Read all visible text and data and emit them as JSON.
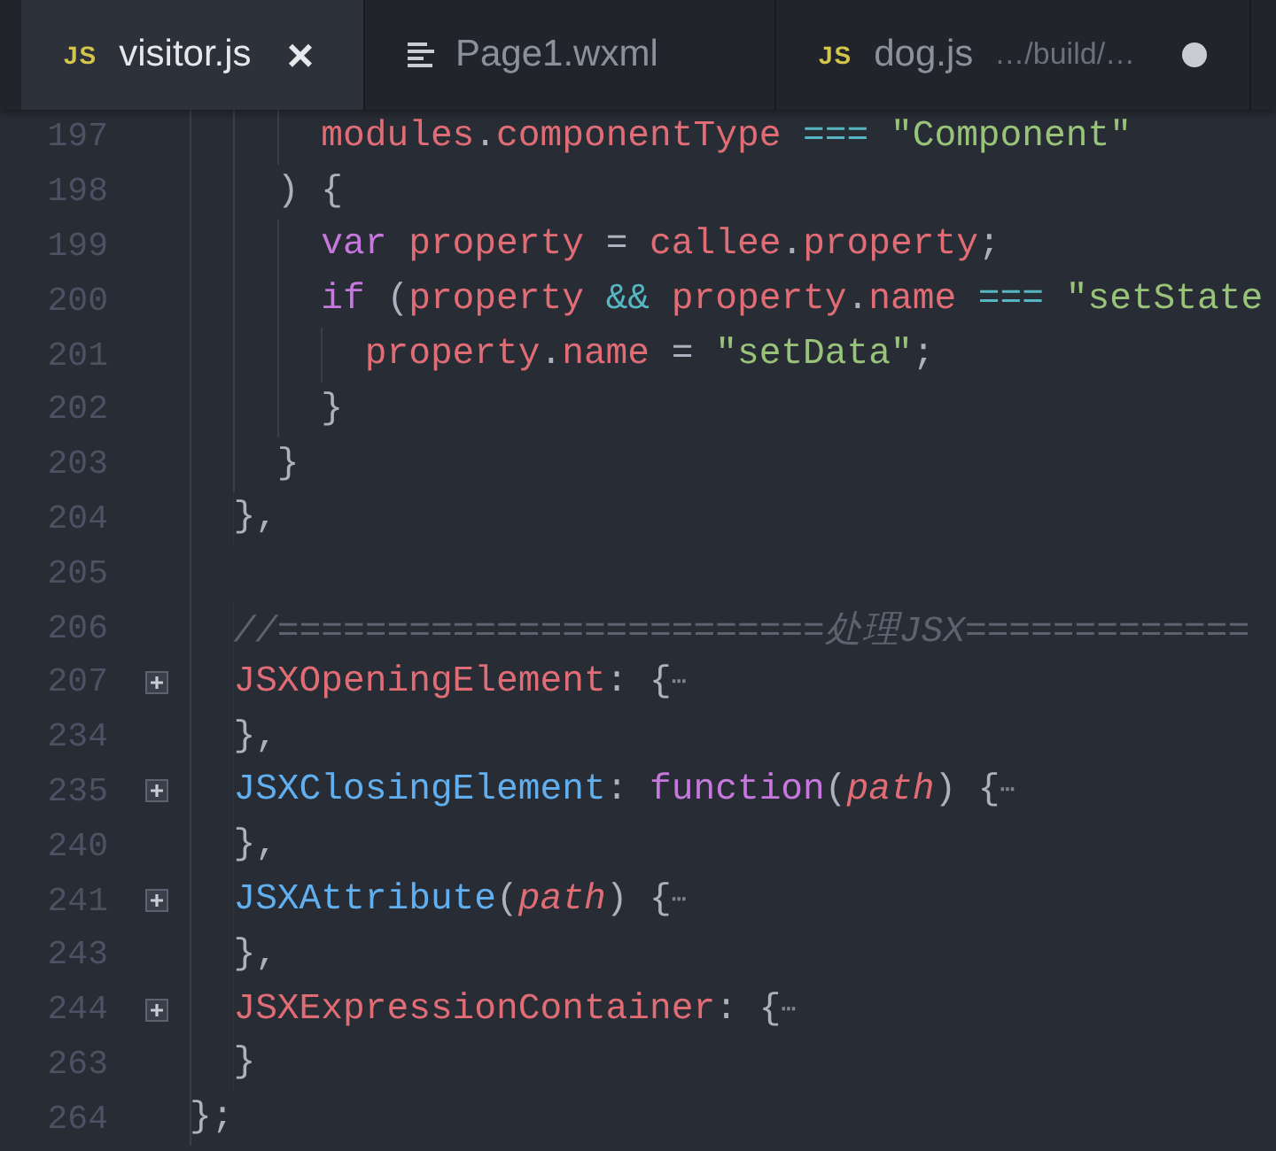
{
  "tabs": [
    {
      "kind": "js",
      "badge": "JS",
      "label": "visitor.js",
      "selected": true,
      "close": "×",
      "modified": false
    },
    {
      "kind": "lines",
      "label": "Page1.wxml",
      "selected": false,
      "modified": false
    },
    {
      "kind": "js",
      "badge": "JS",
      "label": "dog.js",
      "detail": "…/build/…",
      "selected": false,
      "modified": true
    }
  ],
  "lines": [
    {
      "number": "197",
      "folded": false,
      "tokens": [
        {
          "kind": "prop",
          "text": "      modules"
        },
        {
          "kind": "plain",
          "text": "."
        },
        {
          "kind": "prop",
          "text": "componentType"
        },
        {
          "kind": "op",
          "text": " === "
        },
        {
          "kind": "str",
          "text": "\"Component\""
        }
      ]
    },
    {
      "number": "198",
      "folded": false,
      "tokens": [
        {
          "kind": "plain",
          "text": "    ) {"
        }
      ]
    },
    {
      "number": "199",
      "folded": false,
      "tokens": [
        {
          "kind": "kw",
          "text": "      var "
        },
        {
          "kind": "prop",
          "text": "property"
        },
        {
          "kind": "plain",
          "text": " = "
        },
        {
          "kind": "prop",
          "text": "callee"
        },
        {
          "kind": "plain",
          "text": "."
        },
        {
          "kind": "prop",
          "text": "property"
        },
        {
          "kind": "plain",
          "text": ";"
        }
      ]
    },
    {
      "number": "200",
      "folded": false,
      "tokens": [
        {
          "kind": "kw",
          "text": "      if"
        },
        {
          "kind": "plain",
          "text": " ("
        },
        {
          "kind": "prop",
          "text": "property"
        },
        {
          "kind": "op",
          "text": " && "
        },
        {
          "kind": "prop",
          "text": "property"
        },
        {
          "kind": "plain",
          "text": "."
        },
        {
          "kind": "prop",
          "text": "name"
        },
        {
          "kind": "op",
          "text": " === "
        },
        {
          "kind": "str",
          "text": "\"setState"
        }
      ]
    },
    {
      "number": "201",
      "folded": false,
      "tokens": [
        {
          "kind": "prop",
          "text": "        property"
        },
        {
          "kind": "plain",
          "text": "."
        },
        {
          "kind": "prop",
          "text": "name"
        },
        {
          "kind": "plain",
          "text": " = "
        },
        {
          "kind": "str",
          "text": "\"setData\""
        },
        {
          "kind": "plain",
          "text": ";"
        }
      ]
    },
    {
      "number": "202",
      "folded": false,
      "tokens": [
        {
          "kind": "plain",
          "text": "      }"
        }
      ]
    },
    {
      "number": "203",
      "folded": false,
      "tokens": [
        {
          "kind": "plain",
          "text": "    }"
        }
      ]
    },
    {
      "number": "204",
      "folded": false,
      "tokens": [
        {
          "kind": "plain",
          "text": "  },"
        }
      ]
    },
    {
      "number": "205",
      "folded": false
    },
    {
      "number": "206",
      "folded": false,
      "tokens": [
        {
          "kind": "comment",
          "text": "  //=========================处理JSX============="
        }
      ]
    },
    {
      "number": "207",
      "folded": true,
      "tokens": [
        {
          "kind": "prop",
          "text": "  JSXOpeningElement"
        },
        {
          "kind": "plain",
          "text": ": {"
        },
        {
          "kind": "fold",
          "text": "⋯"
        }
      ]
    },
    {
      "number": "234",
      "folded": false,
      "tokens": [
        {
          "kind": "plain",
          "text": "  },"
        }
      ]
    },
    {
      "number": "235",
      "folded": true,
      "tokens": [
        {
          "kind": "fn",
          "text": "  JSXClosingElement"
        },
        {
          "kind": "plain",
          "text": ": "
        },
        {
          "kind": "kw",
          "text": "function"
        },
        {
          "kind": "plain",
          "text": "("
        },
        {
          "kind": "param",
          "text": "path"
        },
        {
          "kind": "plain",
          "text": ") {"
        },
        {
          "kind": "fold",
          "text": "⋯"
        }
      ]
    },
    {
      "number": "240",
      "folded": false,
      "tokens": [
        {
          "kind": "plain",
          "text": "  },"
        }
      ]
    },
    {
      "number": "241",
      "folded": true,
      "tokens": [
        {
          "kind": "fn",
          "text": "  JSXAttribute"
        },
        {
          "kind": "plain",
          "text": "("
        },
        {
          "kind": "param",
          "text": "path"
        },
        {
          "kind": "plain",
          "text": ") {"
        },
        {
          "kind": "fold",
          "text": "⋯"
        }
      ]
    },
    {
      "number": "243",
      "folded": false,
      "tokens": [
        {
          "kind": "plain",
          "text": "  },"
        }
      ]
    },
    {
      "number": "244",
      "folded": true,
      "tokens": [
        {
          "kind": "prop",
          "text": "  JSXExpressionContainer"
        },
        {
          "kind": "plain",
          "text": ": {"
        },
        {
          "kind": "fold",
          "text": "⋯"
        }
      ]
    },
    {
      "number": "263",
      "folded": false,
      "tokens": [
        {
          "kind": "plain",
          "text": "  }"
        }
      ]
    },
    {
      "number": "264",
      "folded": false,
      "tokens": [
        {
          "kind": "plain",
          "text": "};"
        }
      ]
    }
  ]
}
